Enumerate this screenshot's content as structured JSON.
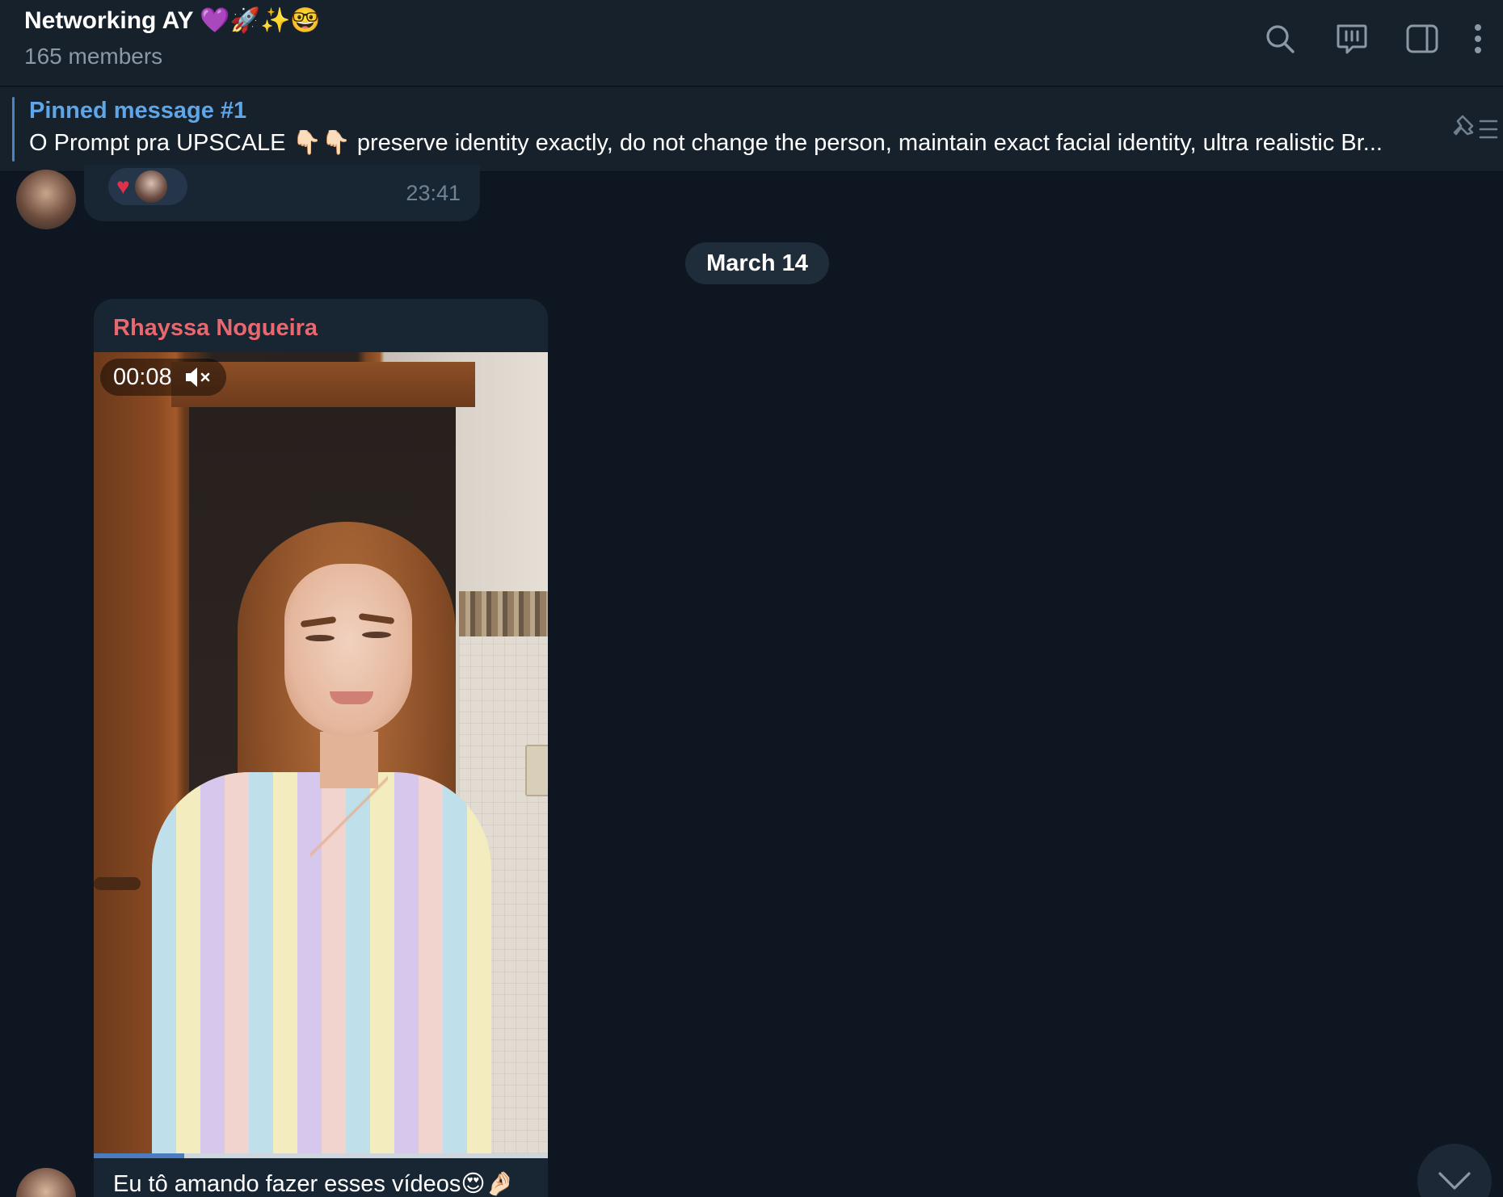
{
  "header": {
    "title": "Networking AY 💜🚀✨🤓",
    "subtitle": "165 members",
    "icons": [
      "search-icon",
      "topics-icon",
      "sidebar-icon",
      "more-icon"
    ]
  },
  "pinned": {
    "title": "Pinned message #1",
    "text": "O Prompt pra UPSCALE 👇🏻👇🏻  preserve identity exactly, do not change the person, maintain exact facial identity, ultra realistic Br..."
  },
  "previous_message": {
    "reaction_emoji": "♥",
    "time": "23:41"
  },
  "date_separator": "March 14",
  "message": {
    "sender": "Rhayssa Nogueira",
    "video_duration": "00:08",
    "video_progress": 0.2,
    "caption": "Eu tô amando fazer esses vídeos😍🤌🏻"
  },
  "colors": {
    "accent": "#5fa6e8",
    "sender_name": "#e8686f",
    "background": "#0e1621",
    "header": "#17212b",
    "bubble": "#182533"
  }
}
